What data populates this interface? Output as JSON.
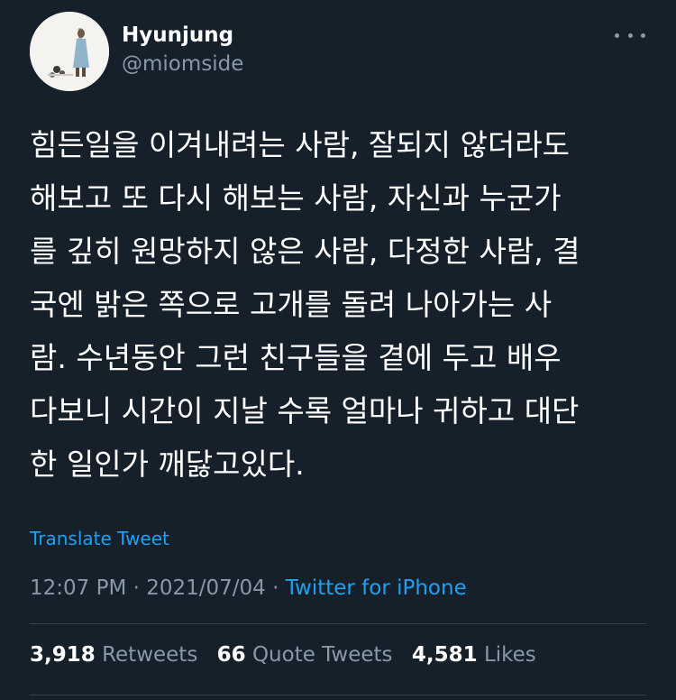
{
  "author": {
    "display_name": "Hyunjung",
    "handle": "@miomside"
  },
  "tweet": {
    "text_lines": [
      "힘든일을 이겨내려는 사람, 잘되지 않더라도",
      "해보고 또 다시 해보는 사람, 자신과 누군가",
      "를 깊히 원망하지 않은 사람, 다정한 사람, 결",
      "국엔 밝은 쪽으로 고개를 돌려 나아가는 사",
      "람. 수년동안 그런 친구들을 곁에 두고 배우",
      "다보니 시간이 지날 수록 얼마나 귀하고 대단",
      "한 일인가 깨닳고있다."
    ],
    "translate_label": "Translate Tweet",
    "time": "12:07 PM",
    "date": "2021/07/04",
    "separator": "·",
    "source": "Twitter for iPhone"
  },
  "stats": {
    "retweets_count": "3,918",
    "retweets_label": "Retweets",
    "quote_count": "66",
    "quote_label": "Quote Tweets",
    "likes_count": "4,581",
    "likes_label": "Likes"
  },
  "icons": {
    "more": "more-horizontal-icon"
  },
  "colors": {
    "background": "#15202b",
    "accent": "#1da1f2",
    "secondary_text": "#8899a6"
  }
}
